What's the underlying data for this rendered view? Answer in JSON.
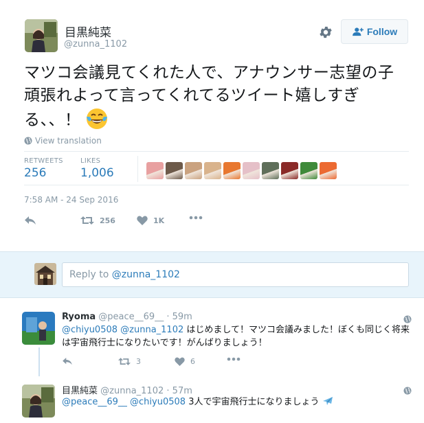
{
  "tweet": {
    "author_name": "目黒純菜",
    "author_handle": "@zunna_1102",
    "follow_label": "Follow",
    "text_lines": [
      "マツコ会議見てくれた人で、アナウンサー志望の子",
      "頑張れよって言ってくれてるツイート嬉しすぎ",
      "る、、！"
    ],
    "emoji": "face-with-tears-of-joy",
    "translate_label": "View translation",
    "retweets_label": "RETWEETS",
    "retweets_value": "256",
    "likes_label": "LIKES",
    "likes_value": "1,006",
    "liker_colors": [
      "#e8a0a0",
      "#6d5a4a",
      "#caa27f",
      "#d9b38c",
      "#e87830",
      "#e5c0c8",
      "#5f6f5a",
      "#8a2a28",
      "#3f8a3a",
      "#ec6a32"
    ],
    "timestamp": "7:58 AM - 24 Sep 2016",
    "actions": {
      "retweet_count": "256",
      "like_count": "1K"
    }
  },
  "reply_box": {
    "prefix": "Reply to ",
    "mention": "@zunna_1102"
  },
  "replies": [
    {
      "name": "Ryoma",
      "handle": "@peace__69__",
      "time": "59m",
      "mentions": "@chiyu0508 @zunna_1102",
      "text": " はじめまして！マツコ会議みました！ぼくも同じく将来は宇宙飛行士になりたいです！がんばりましょう！",
      "retweet_count": "3",
      "like_count": "6"
    },
    {
      "name": "目黒純菜",
      "handle": "@zunna_1102",
      "time": "57m",
      "mentions": "@peace__69__ @chiyu0508",
      "text": " 3人で宇宙飛行士になりましょう",
      "emoji": "airplane"
    }
  ],
  "colors": {
    "link": "#2b7bb9",
    "muted": "#8899a6",
    "reply_bar_bg": "#e8f4fb"
  }
}
